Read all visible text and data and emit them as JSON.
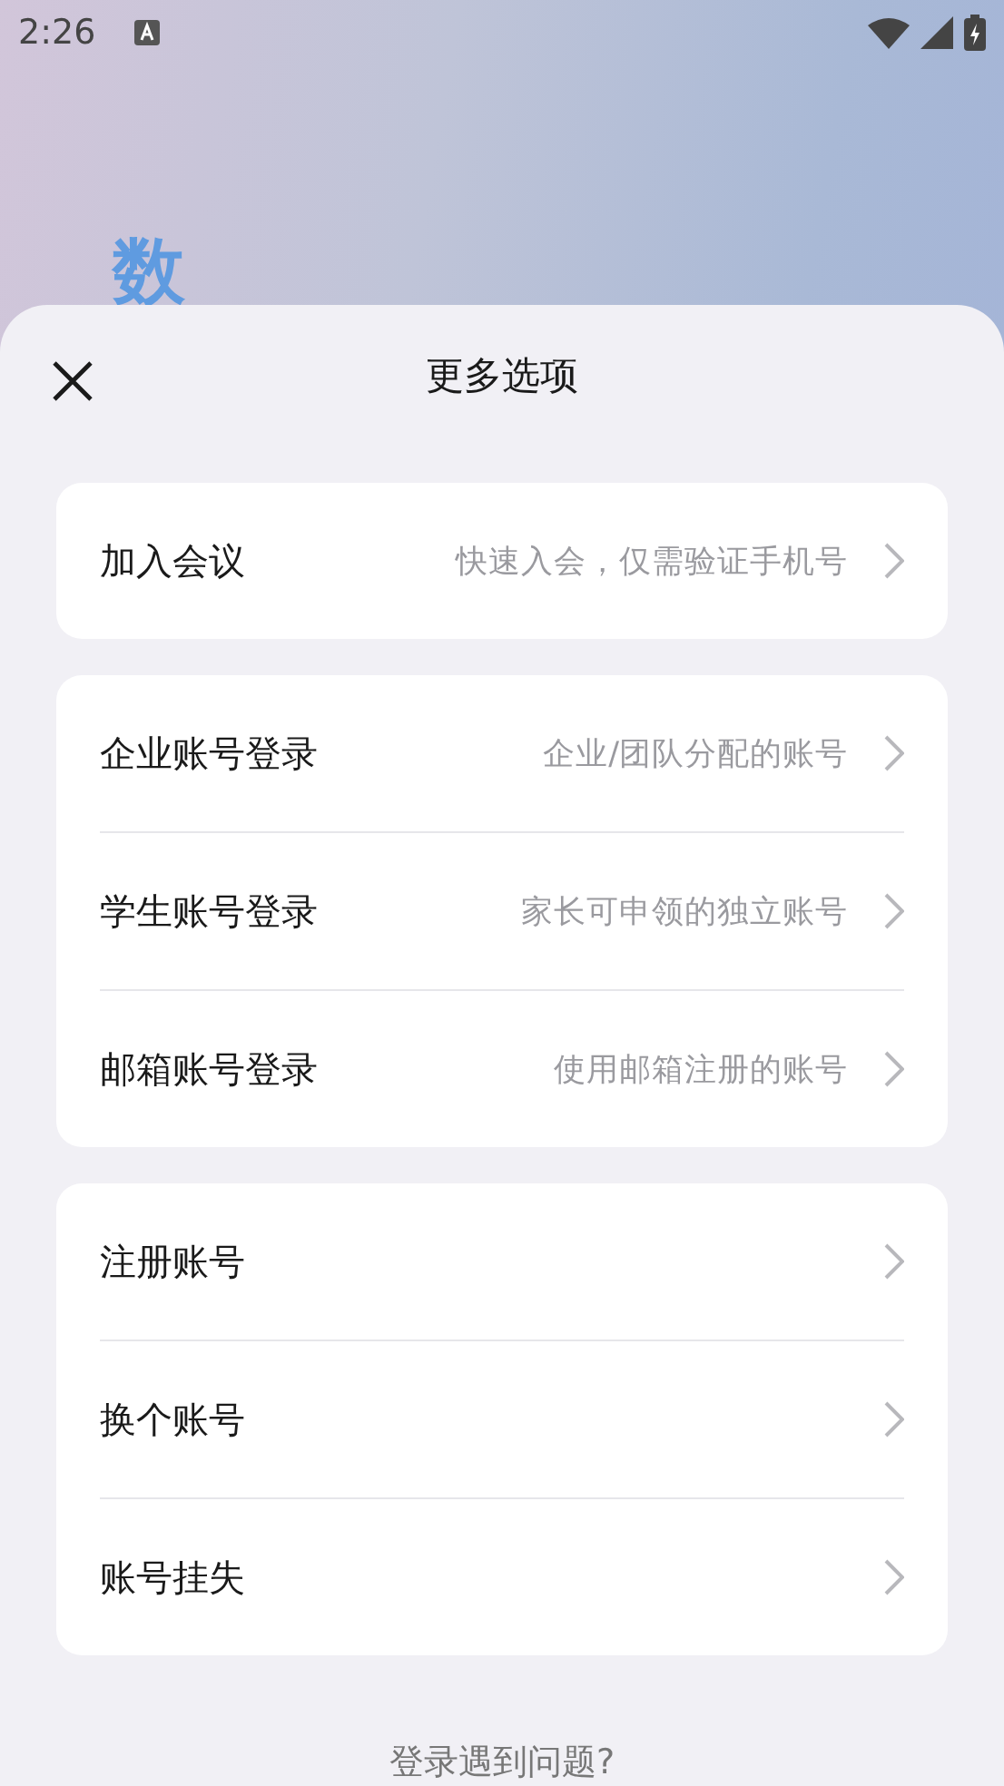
{
  "status_bar": {
    "time": "2:26"
  },
  "background": {
    "logo_text": "数"
  },
  "sheet": {
    "title": "更多选项",
    "groups": [
      {
        "items": [
          {
            "label": "加入会议",
            "hint": "快速入会，仅需验证手机号"
          }
        ]
      },
      {
        "items": [
          {
            "label": "企业账号登录",
            "hint": "企业/团队分配的账号"
          },
          {
            "label": "学生账号登录",
            "hint": "家长可申领的独立账号"
          },
          {
            "label": "邮箱账号登录",
            "hint": "使用邮箱注册的账号"
          }
        ]
      },
      {
        "items": [
          {
            "label": "注册账号"
          },
          {
            "label": "换个账号"
          },
          {
            "label": "账号挂失"
          }
        ]
      }
    ],
    "help_link": "登录遇到问题?"
  }
}
